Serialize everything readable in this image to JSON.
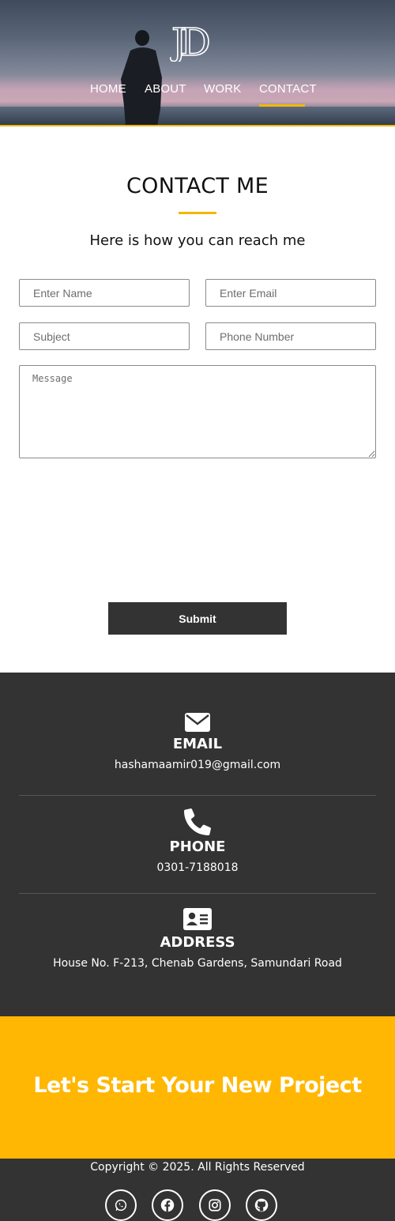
{
  "brand": {
    "logo_text": "JD"
  },
  "nav": {
    "items": [
      "HOME",
      "ABOUT",
      "WORK",
      "CONTACT"
    ],
    "active": "CONTACT"
  },
  "contact": {
    "title": "CONTACT ME",
    "subtitle": "Here is how you can reach me",
    "form": {
      "name_placeholder": "Enter Name",
      "email_placeholder": "Enter Email",
      "subject_placeholder": "Subject",
      "phone_placeholder": "Phone Number",
      "message_placeholder": "Message",
      "submit_label": "Submit"
    }
  },
  "info": {
    "email": {
      "label": "EMAIL",
      "value": "hashamaamir019@gmail.com",
      "icon": "envelope-icon"
    },
    "phone": {
      "label": "PHONE",
      "value": "0301-7188018",
      "icon": "phone-icon"
    },
    "address": {
      "label": "ADDRESS",
      "value": "House No. F-213, Chenab Gardens, Samundari Road",
      "icon": "address-card-icon"
    }
  },
  "cta": {
    "heading": "Let's Start Your New Project"
  },
  "footer": {
    "copyright": "Copyright © 2025. All Rights Reserved",
    "social": [
      "whatsapp-icon",
      "facebook-icon",
      "instagram-icon",
      "github-icon"
    ]
  },
  "colors": {
    "accent": "#f2b705",
    "cta_bg": "#ffb703",
    "dark": "#333333"
  }
}
